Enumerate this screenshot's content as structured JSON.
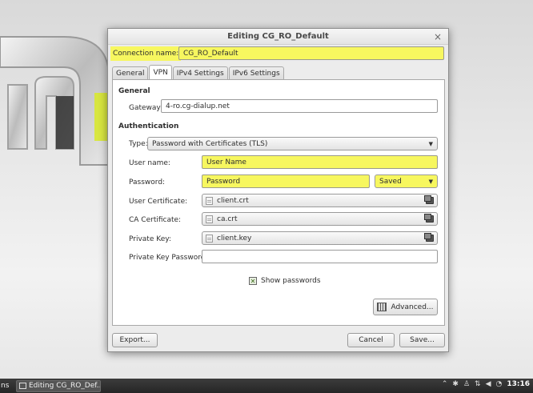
{
  "window": {
    "title": "Editing CG_RO_Default",
    "close_glyph": "×"
  },
  "connection": {
    "name_label": "Connection name:",
    "name_value": "CG_RO_Default"
  },
  "tabs": [
    {
      "label": "General"
    },
    {
      "label": "VPN"
    },
    {
      "label": "IPv4 Settings"
    },
    {
      "label": "IPv6 Settings"
    }
  ],
  "general": {
    "heading": "General",
    "gateway_label": "Gateway:",
    "gateway_value": "4-ro.cg-dialup.net"
  },
  "auth": {
    "heading": "Authentication",
    "type_label": "Type:",
    "type_value": "Password with Certificates (TLS)",
    "username_label": "User name:",
    "username_value": "User Name",
    "password_label": "Password:",
    "password_value": "Password",
    "password_storage": "Saved",
    "user_cert_label": "User Certificate:",
    "user_cert_value": "client.crt",
    "ca_cert_label": "CA Certificate:",
    "ca_cert_value": "ca.crt",
    "private_key_label": "Private Key:",
    "private_key_value": "client.key",
    "private_key_password_label": "Private Key Password:",
    "private_key_password_value": ""
  },
  "show_passwords": {
    "label": "Show passwords",
    "checked": true
  },
  "buttons": {
    "advanced": "Advanced...",
    "export": "Export...",
    "cancel": "Cancel",
    "save": "Save..."
  },
  "taskbar": {
    "start_text": "ns",
    "task_label": "Editing CG_RO_Def...",
    "clock": "13:16"
  },
  "colors": {
    "highlight": "#f7f75f"
  }
}
